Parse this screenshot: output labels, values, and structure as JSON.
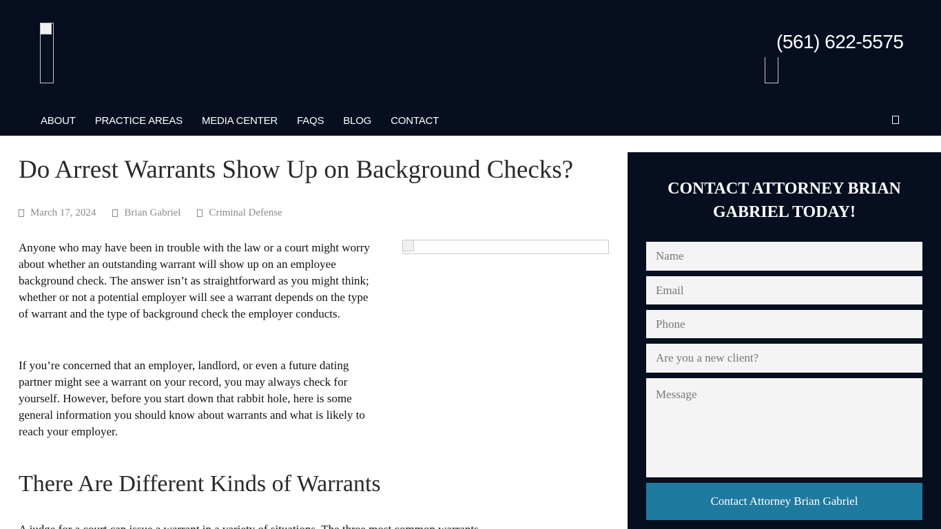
{
  "header": {
    "phone": "(561) 622-5575",
    "nav": [
      "ABOUT",
      "PRACTICE AREAS",
      "MEDIA CENTER",
      "FAQS",
      "BLOG",
      "CONTACT"
    ],
    "search_icon": "search-icon"
  },
  "article": {
    "title": "Do Arrest Warrants Show Up on Background Checks?",
    "date": "March 17, 2024",
    "author": "Brian Gabriel",
    "category": "Criminal Defense",
    "p1": "Anyone who may have been in trouble with the law or a court might worry about whether an outstanding warrant will show up on an employee background check. The answer isn’t as straightforward as you might think; whether or not a potential employer will see a warrant depends on the type of warrant and the type of background check the employer conducts.",
    "p2": "If you’re concerned that an employer, landlord, or even a future dating partner might see a warrant on your record, you may always check for yourself. However, before you start down that rabbit hole, here is some general information you should know about warrants and what is likely to reach your employer.",
    "h2": "There Are Different Kinds of Warrants",
    "p3": "A judge for a court can issue a warrant in a variety of situations. The three most common warrants"
  },
  "sidebar": {
    "title": "CONTACT ATTORNEY BRIAN GABRIEL TODAY!",
    "placeholders": {
      "name": "Name",
      "email": "Email",
      "phone": "Phone",
      "client": "Are you a new client?",
      "message": "Message"
    },
    "submit": "Contact Attorney Brian Gabriel"
  },
  "colors": {
    "header_bg": "#070e1f",
    "accent": "#1f7aa0",
    "field_bg": "#f4f4f4"
  }
}
